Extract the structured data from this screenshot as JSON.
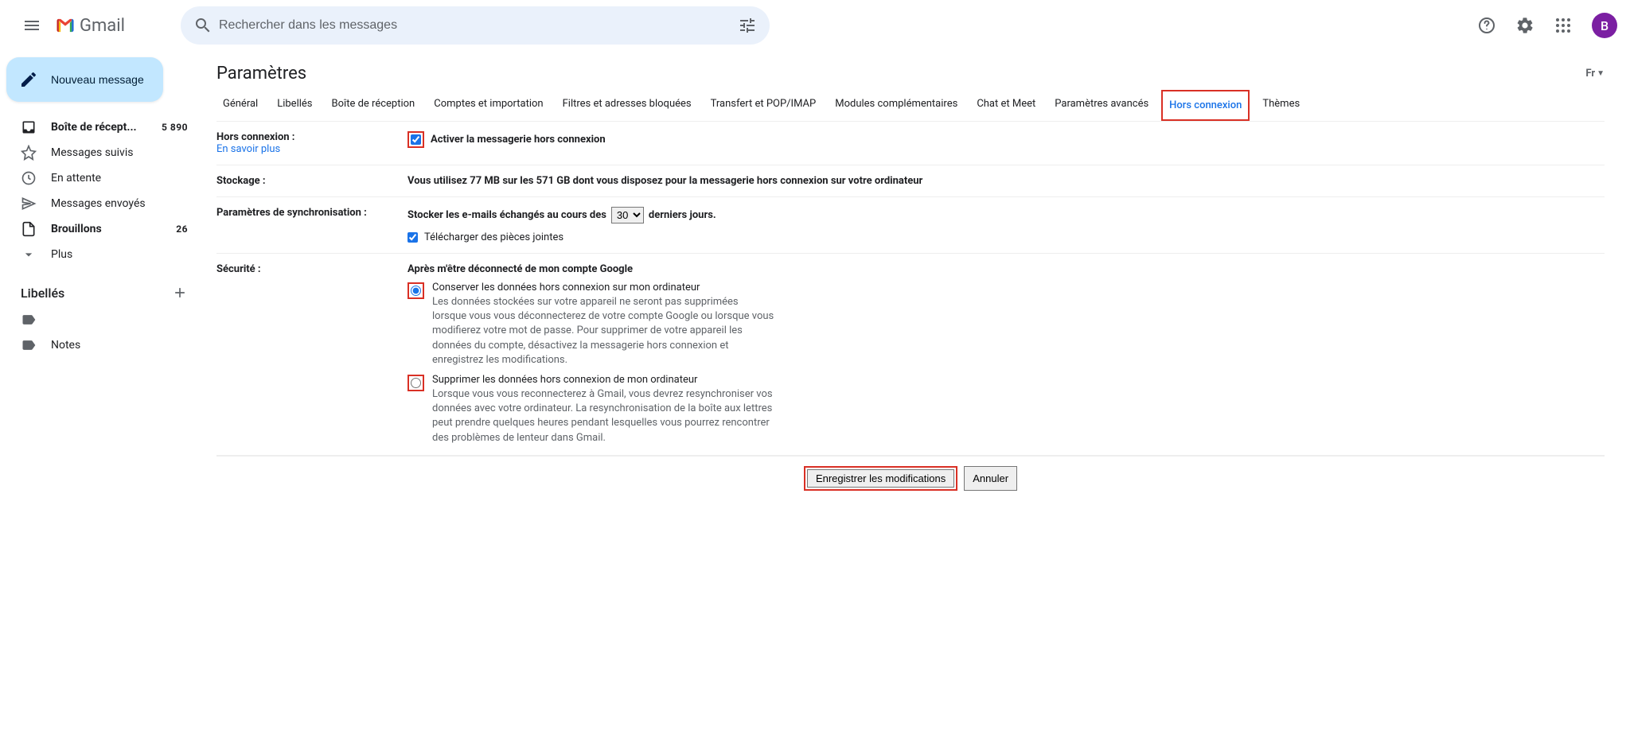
{
  "header": {
    "product": "Gmail",
    "search_placeholder": "Rechercher dans les messages",
    "avatar_letter": "B",
    "locale_label": "Fr"
  },
  "sidebar": {
    "compose_label": "Nouveau message",
    "items": [
      {
        "icon": "inbox",
        "label": "Boîte de récept...",
        "count": "5 890",
        "active": true
      },
      {
        "icon": "star",
        "label": "Messages suivis",
        "count": "",
        "active": false
      },
      {
        "icon": "clock",
        "label": "En attente",
        "count": "",
        "active": false
      },
      {
        "icon": "send",
        "label": "Messages envoyés",
        "count": "",
        "active": false
      },
      {
        "icon": "file",
        "label": "Brouillons",
        "count": "26",
        "active": true
      },
      {
        "icon": "chevron-down",
        "label": "Plus",
        "count": "",
        "active": false
      }
    ],
    "labels_title": "Libellés",
    "label_items": [
      {
        "icon": "label",
        "label": ""
      },
      {
        "icon": "label",
        "label": "Notes"
      }
    ]
  },
  "main": {
    "page_title": "Paramètres",
    "tabs": [
      "Général",
      "Libellés",
      "Boîte de réception",
      "Comptes et importation",
      "Filtres et adresses bloquées",
      "Transfert et POP/IMAP",
      "Modules complémentaires",
      "Chat et Meet",
      "Paramètres avancés",
      "Hors connexion",
      "Thèmes"
    ],
    "active_tab_index": 9,
    "offline": {
      "label": "Hors connexion :",
      "learn_more": "En savoir plus",
      "checkbox_label": "Activer la messagerie hors connexion"
    },
    "storage": {
      "label": "Stockage :",
      "text": "Vous utilisez 77 MB sur les 571 GB dont vous disposez pour la messagerie hors connexion sur votre ordinateur"
    },
    "sync": {
      "label": "Paramètres de synchronisation :",
      "pre_text": "Stocker les e-mails échangés au cours des",
      "select_value": "30",
      "post_text": "derniers jours.",
      "attach_label": "Télécharger des pièces jointes"
    },
    "security": {
      "label": "Sécurité :",
      "heading": "Après m'être déconnecté de mon compte Google",
      "opt1_title": "Conserver les données hors connexion sur mon ordinateur",
      "opt1_desc": "Les données stockées sur votre appareil ne seront pas supprimées lorsque vous vous déconnecterez de votre compte Google ou lorsque vous modifierez votre mot de passe. Pour supprimer de votre appareil les données du compte, désactivez la messagerie hors connexion et enregistrez les modifications.",
      "opt2_title": "Supprimer les données hors connexion de mon ordinateur",
      "opt2_desc": "Lorsque vous vous reconnecterez à Gmail, vous devrez resynchroniser vos données avec votre ordinateur. La resynchronisation de la boîte aux lettres peut prendre quelques heures pendant lesquelles vous pourrez rencontrer des problèmes de lenteur dans Gmail."
    },
    "buttons": {
      "save": "Enregistrer les modifications",
      "cancel": "Annuler"
    }
  }
}
